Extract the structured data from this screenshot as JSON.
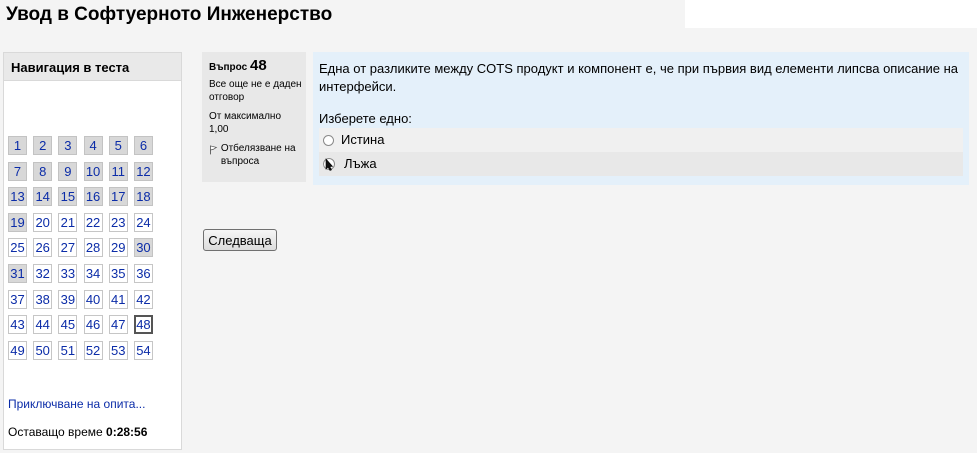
{
  "page": {
    "title": "Увод в Софтуерното Инженерство"
  },
  "navigation": {
    "heading": "Навигация в теста",
    "rows": [
      [
        {
          "n": "1",
          "answered": true
        },
        {
          "n": "2",
          "answered": true
        },
        {
          "n": "3",
          "answered": true
        },
        {
          "n": "4",
          "answered": true
        },
        {
          "n": "5",
          "answered": true
        },
        {
          "n": "6",
          "answered": true
        }
      ],
      [
        {
          "n": "7",
          "answered": true
        },
        {
          "n": "8",
          "answered": true
        },
        {
          "n": "9",
          "answered": true
        },
        {
          "n": "10",
          "answered": true
        },
        {
          "n": "11",
          "answered": true
        },
        {
          "n": "12",
          "answered": true
        }
      ],
      [
        {
          "n": "13",
          "answered": true
        },
        {
          "n": "14",
          "answered": true
        },
        {
          "n": "15",
          "answered": true
        },
        {
          "n": "16",
          "answered": true
        },
        {
          "n": "17",
          "answered": true
        },
        {
          "n": "18",
          "answered": true
        }
      ],
      [
        {
          "n": "19",
          "answered": true
        },
        {
          "n": "20",
          "answered": false
        },
        {
          "n": "21",
          "answered": false
        },
        {
          "n": "22",
          "answered": false
        },
        {
          "n": "23",
          "answered": false
        },
        {
          "n": "24",
          "answered": false
        }
      ],
      [
        {
          "n": "25",
          "answered": false
        },
        {
          "n": "26",
          "answered": false
        },
        {
          "n": "27",
          "answered": false
        },
        {
          "n": "28",
          "answered": false
        },
        {
          "n": "29",
          "answered": false
        },
        {
          "n": "30",
          "answered": true
        }
      ],
      [
        {
          "n": "31",
          "answered": true
        },
        {
          "n": "32",
          "answered": false
        },
        {
          "n": "33",
          "answered": false
        },
        {
          "n": "34",
          "answered": false
        },
        {
          "n": "35",
          "answered": false
        },
        {
          "n": "36",
          "answered": false
        }
      ],
      [
        {
          "n": "37",
          "answered": false
        },
        {
          "n": "38",
          "answered": false
        },
        {
          "n": "39",
          "answered": false
        },
        {
          "n": "40",
          "answered": false
        },
        {
          "n": "41",
          "answered": false
        },
        {
          "n": "42",
          "answered": false
        }
      ],
      [
        {
          "n": "43",
          "answered": false
        },
        {
          "n": "44",
          "answered": false
        },
        {
          "n": "45",
          "answered": false
        },
        {
          "n": "46",
          "answered": false
        },
        {
          "n": "47",
          "answered": false
        },
        {
          "n": "48",
          "answered": false,
          "current": true
        }
      ],
      [
        {
          "n": "49",
          "answered": false
        },
        {
          "n": "50",
          "answered": false
        },
        {
          "n": "51",
          "answered": false
        },
        {
          "n": "52",
          "answered": false
        },
        {
          "n": "53",
          "answered": false
        },
        {
          "n": "54",
          "answered": false
        }
      ]
    ],
    "finish_link": "Приключване на опита...",
    "time_label": "Оставащо време",
    "time_value": "0:28:56"
  },
  "question": {
    "label": "Въпрос",
    "number": "48",
    "state": "Все още не е даден отговор",
    "grade_label": "От максимално",
    "grade_value": "1,00",
    "flag_label": "Отбелязване на въпроса",
    "flag_icon": "flag-icon",
    "text": "Една от разликите между COTS продукт и компонент е, че при първия вид елементи липсва описание на интерфейси.",
    "prompt": "Изберете едно:",
    "options": [
      {
        "label": "Истина"
      },
      {
        "label": "Лъжа"
      }
    ]
  },
  "buttons": {
    "next": "Следваща"
  },
  "colors": {
    "link": "#0b2ca8",
    "question_bg": "#e4f0fa",
    "info_bg": "#e8e8e8"
  }
}
